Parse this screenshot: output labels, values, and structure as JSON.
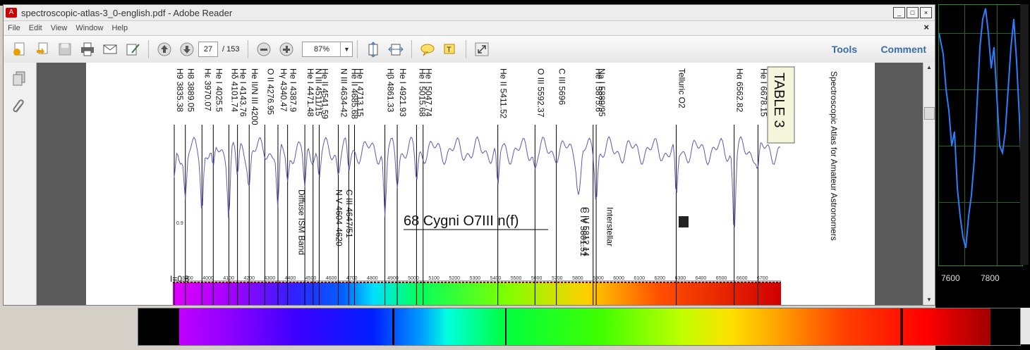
{
  "window": {
    "title": "spectroscopic-atlas-3_0-english.pdf - Adobe Reader",
    "buttons": {
      "minimize": "_",
      "maximize": "□",
      "close": "×"
    }
  },
  "menu": {
    "items": [
      "File",
      "Edit",
      "View",
      "Window",
      "Help"
    ],
    "close_glyph": "×"
  },
  "toolbar": {
    "page_current": "27",
    "page_total": "/ 153",
    "zoom": "87%",
    "tools": "Tools",
    "comment": "Comment"
  },
  "document": {
    "atlas_title": "Spectroscopic Atlas for Amateur Astronomers",
    "table_label": "TABLE 3",
    "star_label": "68 Cygni   O7III n(f)",
    "intensity_label": "I=0.8",
    "y_tick": "0.9",
    "top_lines": [
      "H9 3835.38",
      "H8 3889.05",
      "Hε 3970.07",
      "He I 4025.5",
      "Hδ 4101.74",
      "He I 4143.76",
      "He II/N III 4200",
      "O II 4276.95",
      "Hγ 4340.47",
      "He I 4387.9",
      "He I 4471.48",
      "He II 4541.59",
      "N III 4511/15",
      "N III 4634-42",
      "He II 4685.68",
      "He I 4713.15",
      "Hβ 4861.33",
      "He I 4921.93",
      "He I 5015.68",
      "He I 5047.74",
      "He II 5411.52",
      "O III 5592.37",
      "C III 5696",
      "He I 5875.6",
      "Na I 5889/95",
      "Telluric O2",
      "Hα 6562.82",
      "He I 6678.15"
    ],
    "bottom_lines": [
      "Diffuse ISM Band",
      "N V 4604-4620",
      "C III 4647/51",
      "C IV 5812.14",
      "C IV 5801.51",
      "Interstellar"
    ],
    "x_ticks": [
      "3900",
      "4000",
      "4100",
      "4200",
      "4300",
      "4400",
      "4500",
      "4600",
      "4700",
      "4800",
      "4900",
      "5000",
      "5100",
      "5200",
      "5300",
      "5400",
      "5500",
      "5600",
      "5700",
      "5800",
      "5900",
      "6000",
      "6100",
      "6200",
      "6300",
      "6400",
      "6500",
      "6600",
      "6700"
    ]
  },
  "background_plot": {
    "x_ticks": [
      "7600",
      "7800"
    ],
    "line_color": "#2a7fff",
    "grid_color": "#1c6b1c"
  }
}
